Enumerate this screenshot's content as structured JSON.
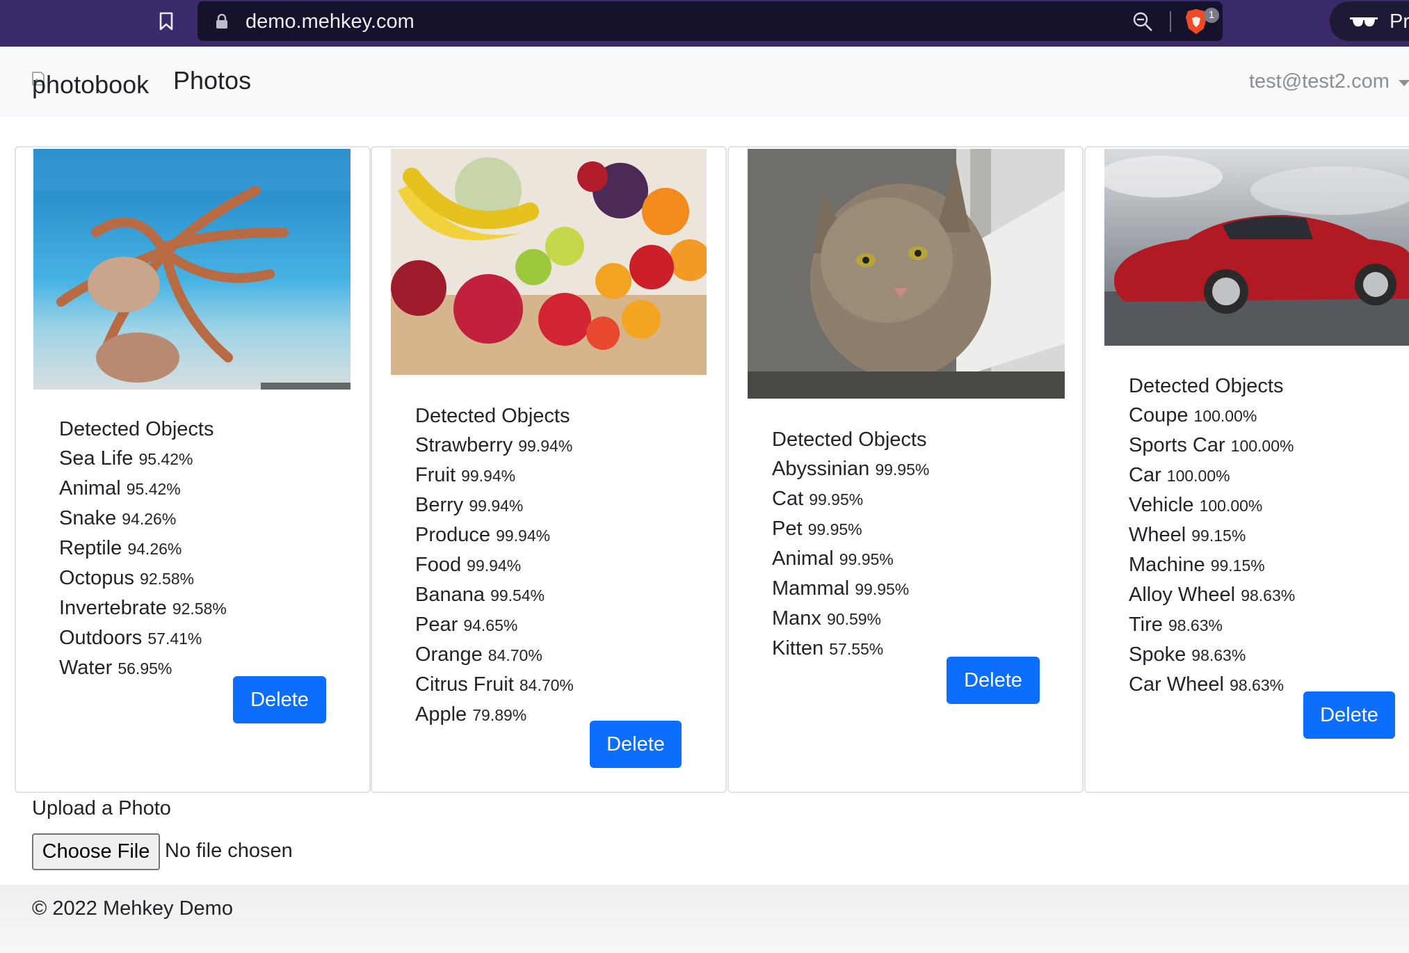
{
  "browser": {
    "url": "demo.mehkey.com",
    "brave_badge_count": "1",
    "private_label": "Pr"
  },
  "navbar": {
    "logo_alt": "photobook",
    "brand": "Photos",
    "user_email": "test@test2.com"
  },
  "cards": [
    {
      "image": "octopus underwater",
      "heading": "Detected Objects",
      "objects": [
        {
          "label": "Sea Life",
          "confidence": "95.42%"
        },
        {
          "label": "Animal",
          "confidence": "95.42%"
        },
        {
          "label": "Snake",
          "confidence": "94.26%"
        },
        {
          "label": "Reptile",
          "confidence": "94.26%"
        },
        {
          "label": "Octopus",
          "confidence": "92.58%"
        },
        {
          "label": "Invertebrate",
          "confidence": "92.58%"
        },
        {
          "label": "Outdoors",
          "confidence": "57.41%"
        },
        {
          "label": "Water",
          "confidence": "56.95%"
        }
      ],
      "delete_label": "Delete"
    },
    {
      "image": "assorted fruits",
      "heading": "Detected Objects",
      "objects": [
        {
          "label": "Strawberry",
          "confidence": "99.94%"
        },
        {
          "label": "Fruit",
          "confidence": "99.94%"
        },
        {
          "label": "Berry",
          "confidence": "99.94%"
        },
        {
          "label": "Produce",
          "confidence": "99.94%"
        },
        {
          "label": "Food",
          "confidence": "99.94%"
        },
        {
          "label": "Banana",
          "confidence": "99.54%"
        },
        {
          "label": "Pear",
          "confidence": "94.65%"
        },
        {
          "label": "Orange",
          "confidence": "84.70%"
        },
        {
          "label": "Citrus Fruit",
          "confidence": "84.70%"
        },
        {
          "label": "Apple",
          "confidence": "79.89%"
        }
      ],
      "delete_label": "Delete"
    },
    {
      "image": "tabby cat",
      "heading": "Detected Objects",
      "objects": [
        {
          "label": "Abyssinian",
          "confidence": "99.95%"
        },
        {
          "label": "Cat",
          "confidence": "99.95%"
        },
        {
          "label": "Pet",
          "confidence": "99.95%"
        },
        {
          "label": "Animal",
          "confidence": "99.95%"
        },
        {
          "label": "Mammal",
          "confidence": "99.95%"
        },
        {
          "label": "Manx",
          "confidence": "90.59%"
        },
        {
          "label": "Kitten",
          "confidence": "57.55%"
        }
      ],
      "delete_label": "Delete"
    },
    {
      "image": "red sports car",
      "heading": "Detected Objects",
      "objects": [
        {
          "label": "Coupe",
          "confidence": "100.00%"
        },
        {
          "label": "Sports Car",
          "confidence": "100.00%"
        },
        {
          "label": "Car",
          "confidence": "100.00%"
        },
        {
          "label": "Vehicle",
          "confidence": "100.00%"
        },
        {
          "label": "Wheel",
          "confidence": "99.15%"
        },
        {
          "label": "Machine",
          "confidence": "99.15%"
        },
        {
          "label": "Alloy Wheel",
          "confidence": "98.63%"
        },
        {
          "label": "Tire",
          "confidence": "98.63%"
        },
        {
          "label": "Spoke",
          "confidence": "98.63%"
        },
        {
          "label": "Car Wheel",
          "confidence": "98.63%"
        }
      ],
      "delete_label": "Delete"
    }
  ],
  "upload": {
    "label": "Upload a Photo",
    "button_label": "Choose File",
    "status": "No file chosen"
  },
  "footer": {
    "text": "© 2022 Mehkey Demo"
  },
  "colors": {
    "primary": "#0d6efd",
    "browser_frame": "#3a2a6b",
    "navbar_bg": "#f8f9fa"
  }
}
